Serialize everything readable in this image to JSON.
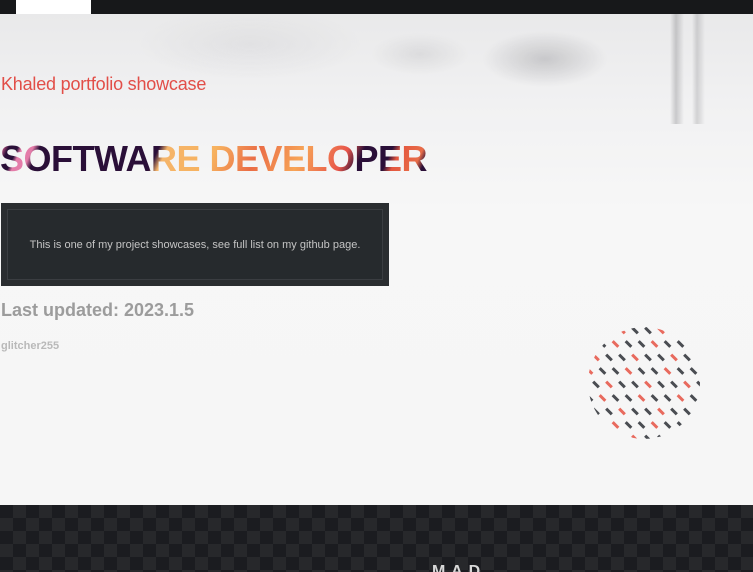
{
  "topbar": {
    "tab_label": ""
  },
  "hero": {
    "subtitle": "Khaled portfolio showcase",
    "headline": "SOFTWARE DEVELOPER"
  },
  "note": {
    "text": "This is one of my project showcases, see full list on my github page."
  },
  "meta": {
    "updated": "Last updated: 2023.1.5",
    "author": "glitcher255"
  },
  "footer": {
    "text": "M A D"
  },
  "colors": {
    "accent_red": "#e24e48",
    "headline_dark": "#2a0f38",
    "headline_orange": "#f7b25f",
    "note_bg": "#2a2d30",
    "footer_bg": "#1b1c20"
  }
}
